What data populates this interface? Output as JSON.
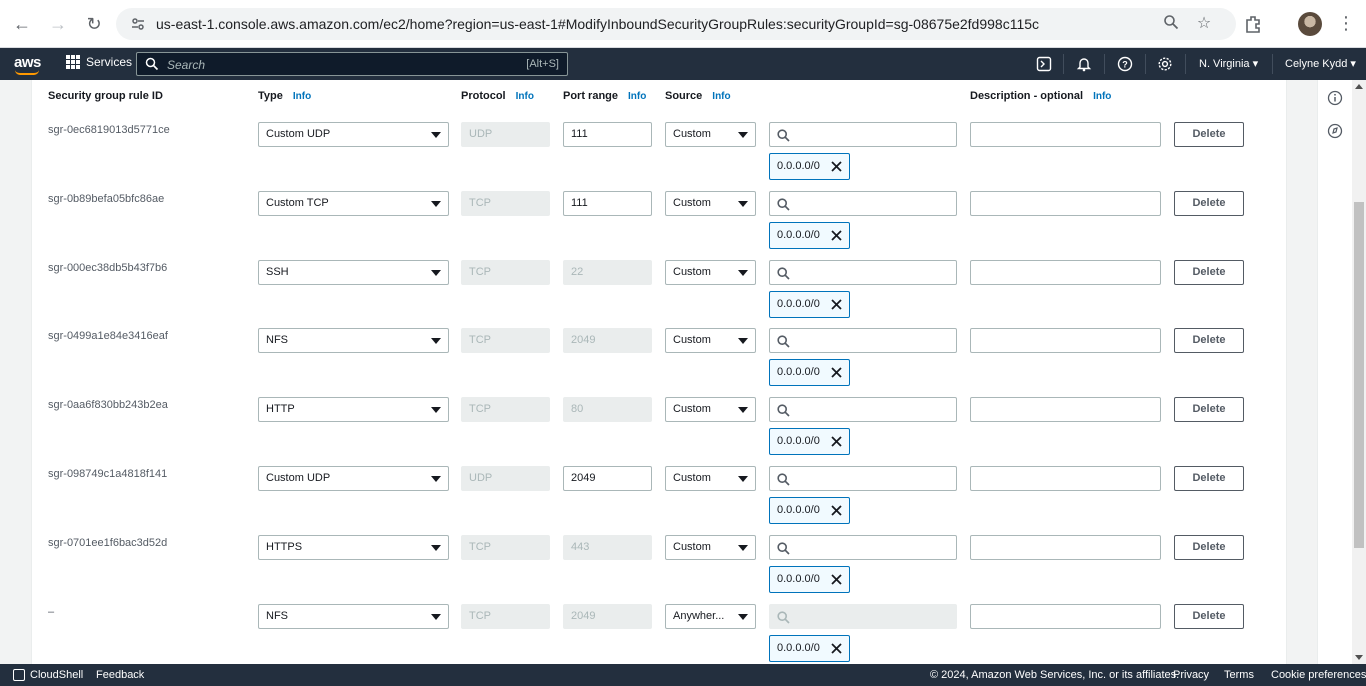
{
  "browser": {
    "url": "us-east-1.console.aws.amazon.com/ec2/home?region=us-east-1#ModifyInboundSecurityGroupRules:securityGroupId=sg-08675e2fd998c115c"
  },
  "aws_nav": {
    "logo": "aws",
    "services_label": "Services",
    "search_placeholder": "Search",
    "search_shortcut": "[Alt+S]",
    "region": "N. Virginia ▾",
    "user": "Celyne Kydd ▾"
  },
  "headers": {
    "rule_id": "Security group rule ID",
    "type": "Type",
    "protocol": "Protocol",
    "port_range": "Port range",
    "source": "Source",
    "description": "Description - optional",
    "info": "Info"
  },
  "rules": [
    {
      "id": "sgr-0ec6819013d5771ce",
      "type": "Custom UDP",
      "protocol": "UDP",
      "port": "111",
      "port_editable": true,
      "source": "Custom",
      "source_editable": true,
      "cidr": "0.0.0.0/0",
      "delete": "Delete"
    },
    {
      "id": "sgr-0b89befa05bfc86ae",
      "type": "Custom TCP",
      "protocol": "TCP",
      "port": "111",
      "port_editable": true,
      "source": "Custom",
      "source_editable": true,
      "cidr": "0.0.0.0/0",
      "delete": "Delete"
    },
    {
      "id": "sgr-000ec38db5b43f7b6",
      "type": "SSH",
      "protocol": "TCP",
      "port": "22",
      "port_editable": false,
      "source": "Custom",
      "source_editable": true,
      "cidr": "0.0.0.0/0",
      "delete": "Delete"
    },
    {
      "id": "sgr-0499a1e84e3416eaf",
      "type": "NFS",
      "protocol": "TCP",
      "port": "2049",
      "port_editable": false,
      "source": "Custom",
      "source_editable": true,
      "cidr": "0.0.0.0/0",
      "delete": "Delete"
    },
    {
      "id": "sgr-0aa6f830bb243b2ea",
      "type": "HTTP",
      "protocol": "TCP",
      "port": "80",
      "port_editable": false,
      "source": "Custom",
      "source_editable": true,
      "cidr": "0.0.0.0/0",
      "delete": "Delete"
    },
    {
      "id": "sgr-098749c1a4818f141",
      "type": "Custom UDP",
      "protocol": "UDP",
      "port": "2049",
      "port_editable": true,
      "source": "Custom",
      "source_editable": true,
      "cidr": "0.0.0.0/0",
      "delete": "Delete"
    },
    {
      "id": "sgr-0701ee1f6bac3d52d",
      "type": "HTTPS",
      "protocol": "TCP",
      "port": "443",
      "port_editable": false,
      "source": "Custom",
      "source_editable": true,
      "cidr": "0.0.0.0/0",
      "delete": "Delete"
    },
    {
      "id": "–",
      "type": "NFS",
      "protocol": "TCP",
      "port": "2049",
      "port_editable": false,
      "source": "Anywher...",
      "source_editable": false,
      "cidr": "0.0.0.0/0",
      "delete": "Delete"
    }
  ],
  "footer": {
    "cloudshell": "CloudShell",
    "feedback": "Feedback",
    "copyright": "© 2024, Amazon Web Services, Inc. or its affiliates.",
    "privacy": "Privacy",
    "terms": "Terms",
    "cookies": "Cookie preferences"
  },
  "colors": {
    "nav_bg": "#232f3e",
    "link": "#0073bb",
    "accent": "#ff9900"
  }
}
